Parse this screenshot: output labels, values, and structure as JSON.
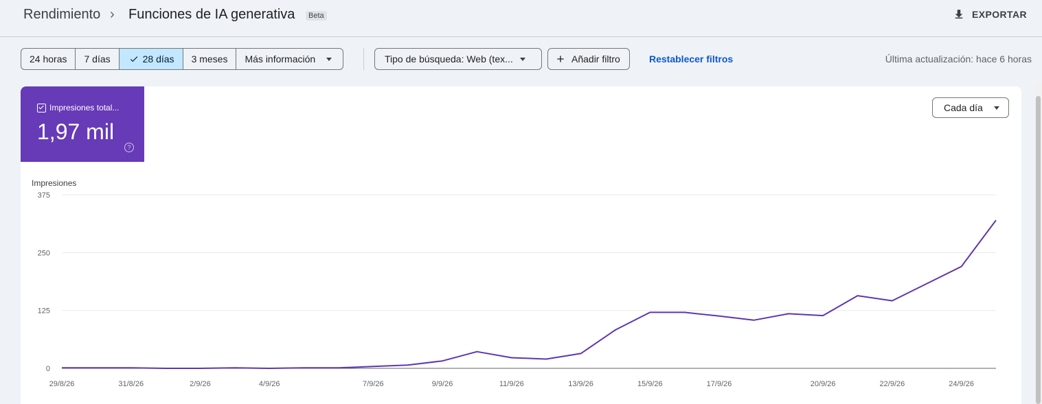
{
  "breadcrumb": {
    "parent": "Rendimiento",
    "separator": "›",
    "current": "Funciones de IA generativa",
    "badge": "Beta"
  },
  "header": {
    "export_label": "EXPORTAR",
    "export_icon": "download-icon"
  },
  "toolbar": {
    "ranges": [
      {
        "label": "24 horas",
        "active": false
      },
      {
        "label": "7 días",
        "active": false
      },
      {
        "label": "28 días",
        "active": true
      },
      {
        "label": "3 meses",
        "active": false
      },
      {
        "label": "Más información",
        "active": false
      }
    ],
    "search_type": "Tipo de búsqueda: Web (tex...",
    "add_filter": "Añadir filtro",
    "reset_filters": "Restablecer filtros",
    "last_update": "Última actualización: hace 6 horas"
  },
  "metric": {
    "label": "Impresiones total...",
    "value": "1,97 mil",
    "help": "?",
    "color": "#673ab7"
  },
  "granularity": {
    "label": "Cada día"
  },
  "chart_data": {
    "type": "line",
    "ylabel": "Impresiones",
    "ylim": [
      0,
      375
    ],
    "yticks": [
      "375",
      "250",
      "125",
      "0"
    ],
    "x_tick_labels": [
      "29/8/26",
      "31/8/26",
      "2/9/26",
      "4/9/26",
      "7/9/26",
      "9/9/26",
      "11/9/26",
      "13/9/26",
      "15/9/26",
      "17/9/26",
      "20/9/26",
      "22/9/26",
      "24/9/26"
    ],
    "x": [
      "29/8/26",
      "30/8/26",
      "31/8/26",
      "1/9/26",
      "2/9/26",
      "3/9/26",
      "4/9/26",
      "5/9/26",
      "6/9/26",
      "7/9/26",
      "8/9/26",
      "9/9/26",
      "10/9/26",
      "11/9/26",
      "12/9/26",
      "13/9/26",
      "14/9/26",
      "15/9/26",
      "16/9/26",
      "17/9/26",
      "18/9/26",
      "19/9/26",
      "20/9/26",
      "21/9/26",
      "22/9/26",
      "23/9/26",
      "24/9/26",
      "25/9/26"
    ],
    "series": [
      {
        "color": "#5e35b1",
        "values": [
          1,
          1,
          1,
          0,
          0,
          1,
          0,
          1,
          1,
          4,
          7,
          16,
          36,
          23,
          20,
          32,
          83,
          121,
          121,
          113,
          104,
          118,
          114,
          157,
          146,
          183,
          220,
          320
        ]
      }
    ],
    "grid": true
  }
}
